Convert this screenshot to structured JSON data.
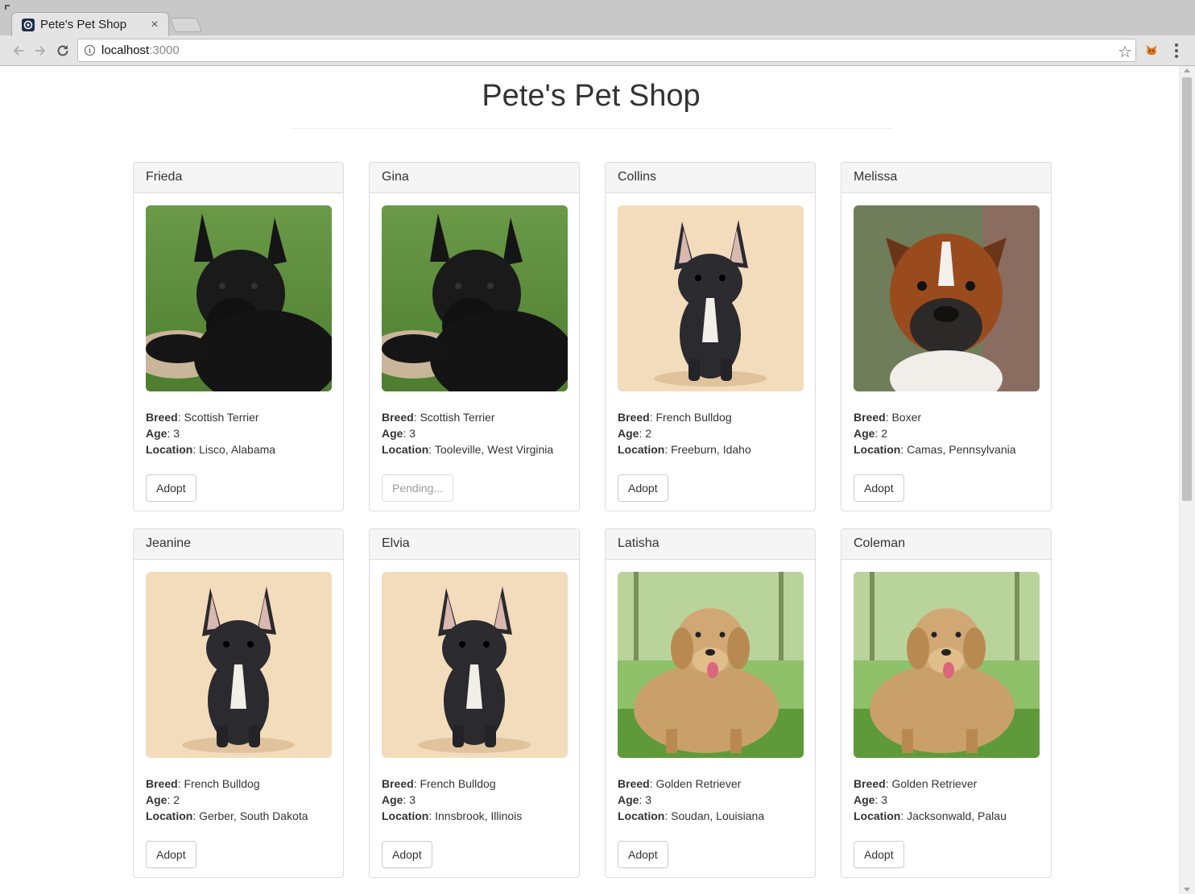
{
  "browser": {
    "tab_title": "Pete's Pet Shop",
    "tab_close": "×",
    "url_host": "localhost",
    "url_port": ":3000"
  },
  "page": {
    "title": "Pete's Pet Shop"
  },
  "labels": {
    "breed": "Breed",
    "age": "Age",
    "location": "Location"
  },
  "pets": [
    {
      "name": "Frieda",
      "breed": "Scottish Terrier",
      "age": "3",
      "location": "Lisco, Alabama",
      "button": "Adopt",
      "image": "scottish-terrier"
    },
    {
      "name": "Gina",
      "breed": "Scottish Terrier",
      "age": "3",
      "location": "Tooleville, West Virginia",
      "button": "Pending...",
      "image": "scottish-terrier"
    },
    {
      "name": "Collins",
      "breed": "French Bulldog",
      "age": "2",
      "location": "Freeburn, Idaho",
      "button": "Adopt",
      "image": "french-bulldog"
    },
    {
      "name": "Melissa",
      "breed": "Boxer",
      "age": "2",
      "location": "Camas, Pennsylvania",
      "button": "Adopt",
      "image": "boxer"
    },
    {
      "name": "Jeanine",
      "breed": "French Bulldog",
      "age": "2",
      "location": "Gerber, South Dakota",
      "button": "Adopt",
      "image": "french-bulldog"
    },
    {
      "name": "Elvia",
      "breed": "French Bulldog",
      "age": "3",
      "location": "Innsbrook, Illinois",
      "button": "Adopt",
      "image": "french-bulldog"
    },
    {
      "name": "Latisha",
      "breed": "Golden Retriever",
      "age": "3",
      "location": "Soudan, Louisiana",
      "button": "Adopt",
      "image": "golden-retriever"
    },
    {
      "name": "Coleman",
      "breed": "Golden Retriever",
      "age": "3",
      "location": "Jacksonwald, Palau",
      "button": "Adopt",
      "image": "golden-retriever"
    }
  ]
}
